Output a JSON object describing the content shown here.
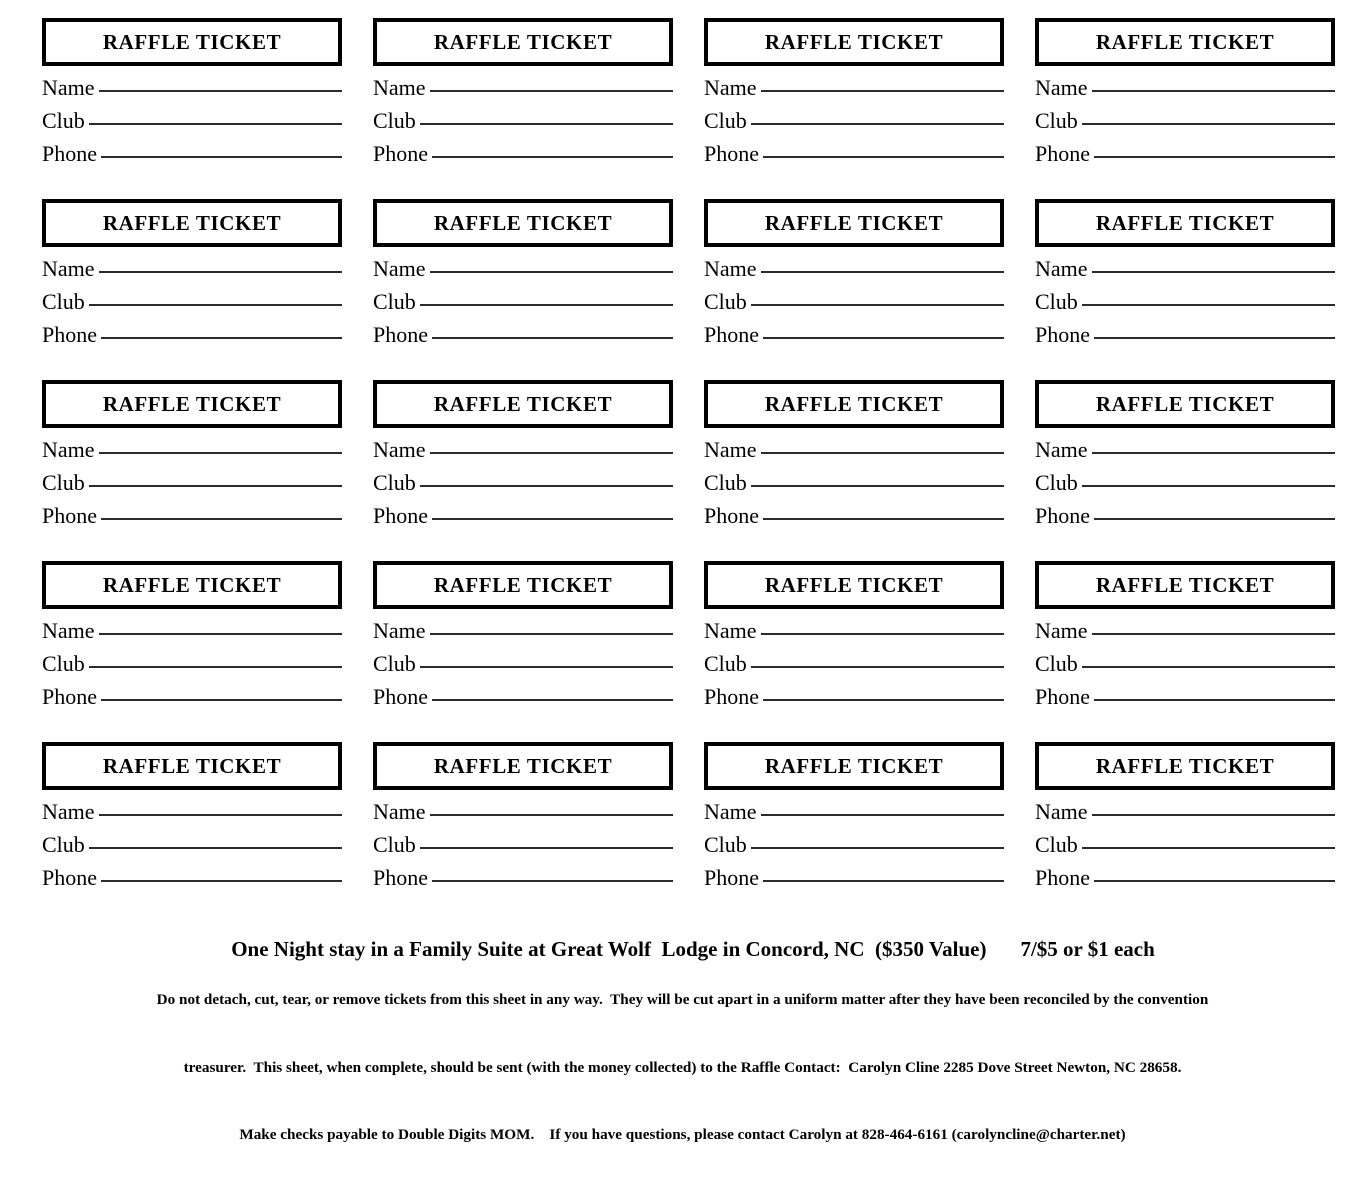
{
  "document": {
    "type": "raffle-ticket-sheet",
    "ticket_title": "RAFFLE TICKET",
    "columns": 4,
    "rows": 5,
    "total_tickets": 20,
    "field_labels": {
      "name": "Name",
      "club": "Club",
      "phone": "Phone"
    }
  },
  "prize": {
    "description": "One Night stay in a Family Suite at Great Wolf  Lodge in Concord, NC  ($350 Value)",
    "price": "7/$5 or $1 each"
  },
  "disclaimer": {
    "line1": "Do not detach, cut, tear, or remove tickets from this sheet in any way.  They will be cut apart in a uniform matter after they have been reconciled by the convention",
    "line2": "treasurer.  This sheet, when complete, should be sent (with the money collected) to the Raffle Contact:  Carolyn Cline 2285 Dove Street Newton, NC 28658.",
    "line3": "Make checks payable to Double Digits MOM.    If you have questions, please contact Carolyn at 828-464-6161 (carolyncline@charter.net)"
  },
  "contact": {
    "name": "Carolyn Cline",
    "address": "2285 Dove Street Newton, NC 28658",
    "phone": "828-464-6161",
    "email": "carolyncline@charter.net",
    "organization": "Double Digits MOM"
  },
  "colors": {
    "border": "#000000",
    "text": "#000000",
    "rule": "#2b2b2b",
    "background": "#ffffff"
  },
  "tickets": [
    {
      "index": 1
    },
    {
      "index": 2
    },
    {
      "index": 3
    },
    {
      "index": 4
    },
    {
      "index": 5
    },
    {
      "index": 6
    },
    {
      "index": 7
    },
    {
      "index": 8
    },
    {
      "index": 9
    },
    {
      "index": 10
    },
    {
      "index": 11
    },
    {
      "index": 12
    },
    {
      "index": 13
    },
    {
      "index": 14
    },
    {
      "index": 15
    },
    {
      "index": 16
    },
    {
      "index": 17
    },
    {
      "index": 18
    },
    {
      "index": 19
    },
    {
      "index": 20
    }
  ]
}
